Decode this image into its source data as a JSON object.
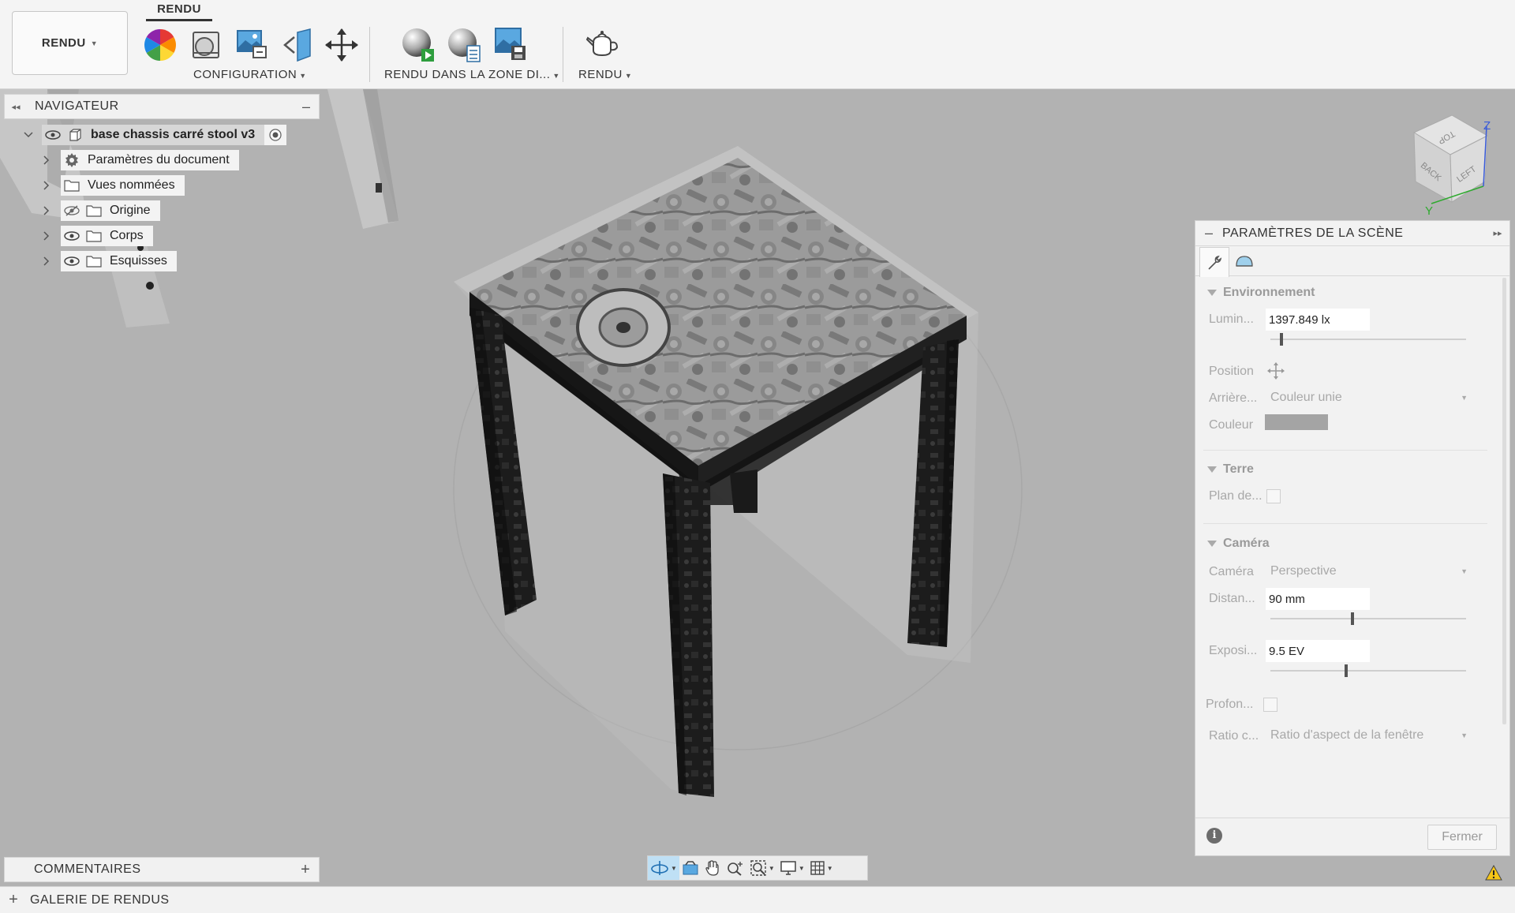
{
  "toolbar": {
    "workspace": "RENDU",
    "active_tab": "RENDU",
    "groups": {
      "configuration": "CONFIGURATION",
      "render_in_zone": "RENDU DANS LA ZONE DI...",
      "render": "RENDU"
    },
    "tools": [
      "appearance-icon",
      "scene-settings-icon",
      "texture-map-icon",
      "decal-icon",
      "move-icon",
      "in-canvas-render-icon",
      "render-settings-icon",
      "capture-image-icon",
      "teapot-render-icon"
    ]
  },
  "navigator": {
    "title": "NAVIGATEUR",
    "root": "base chassis carré stool v3",
    "items": [
      {
        "label": "Paramètres du document",
        "icon": "gear-icon"
      },
      {
        "label": "Vues nommées",
        "icon": "folder-icon"
      },
      {
        "label": "Origine",
        "icon": "folder-icon",
        "visibility": "hidden"
      },
      {
        "label": "Corps",
        "icon": "folder-icon",
        "visibility": "visible"
      },
      {
        "label": "Esquisses",
        "icon": "folder-icon",
        "visibility": "visible"
      }
    ]
  },
  "viewcube": {
    "top": "TOP",
    "back": "BACK",
    "left": "LEFT",
    "axis_z": "Z",
    "axis_y": "Y"
  },
  "comments": {
    "title": "COMMENTAIRES"
  },
  "gallery": {
    "title": "GALERIE DE RENDUS"
  },
  "scene_panel": {
    "title": "PARAMÈTRES DE LA SCÈNE",
    "sections": {
      "environment": "Environnement",
      "ground": "Terre",
      "camera": "Caméra"
    },
    "labels": {
      "luminance": "Lumin...",
      "position": "Position",
      "background": "Arrière...",
      "color": "Couleur",
      "ground_plane": "Plan de...",
      "camera": "Caméra",
      "distance": "Distan...",
      "exposure": "Exposi...",
      "depth": "Profon...",
      "ratio": "Ratio c..."
    },
    "values": {
      "luminance": "1397.849 lx",
      "background": "Couleur unie",
      "background_color": "#a4a4a4",
      "camera": "Perspective",
      "distance": "90 mm",
      "exposure": "9.5 EV",
      "ratio": "Ratio d'aspect de la fenêtre"
    },
    "sliders": {
      "luminance": 0.05,
      "distance": 0.41,
      "exposure": 0.38
    },
    "close": "Fermer"
  }
}
